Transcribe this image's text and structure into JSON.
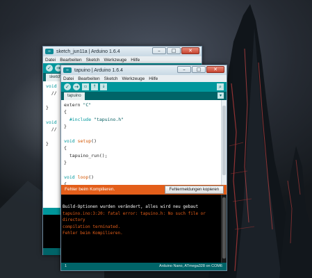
{
  "colors": {
    "teal": "#00979c",
    "dark_teal": "#006468",
    "error_orange": "#e35e1a",
    "console_bg": "#000000"
  },
  "back_window": {
    "title": "sketch_jun11a | Arduino 1.6.4",
    "menu": [
      "Datei",
      "Bearbeiten",
      "Sketch",
      "Werkzeuge",
      "Hilfe"
    ],
    "tab": "sketch_jun11a",
    "code": [
      "void",
      "  //",
      "",
      "}",
      "",
      "void",
      "  //",
      "",
      "}"
    ]
  },
  "front_window": {
    "title": "tapuino | Arduino 1.6.4",
    "menu": [
      "Datei",
      "Bearbeiten",
      "Sketch",
      "Werkzeuge",
      "Hilfe"
    ],
    "toolbar_icons": [
      "verify-icon",
      "upload-icon",
      "new-icon",
      "open-icon",
      "save-icon",
      "serial-monitor-icon"
    ],
    "tab": "tapuino",
    "status_message": "Fehler beim Kompilieren.",
    "copy_button": "Fehlermeldungen kopieren",
    "console": [
      {
        "text": "Build-Optionen wurden verändert, alles wird neu gebaut",
        "type": "info"
      },
      {
        "text": "tapuino.ino:3:20: fatal error: tapuino.h: No such file or",
        "type": "error"
      },
      {
        "text": "directory",
        "type": "error"
      },
      {
        "text": "compilation terminated.",
        "type": "error"
      },
      {
        "text": "Fehler beim Kompilieren.",
        "type": "error"
      }
    ],
    "footer_line": "1",
    "footer_board": "Arduino Nano, ATmega328 on COM6"
  }
}
